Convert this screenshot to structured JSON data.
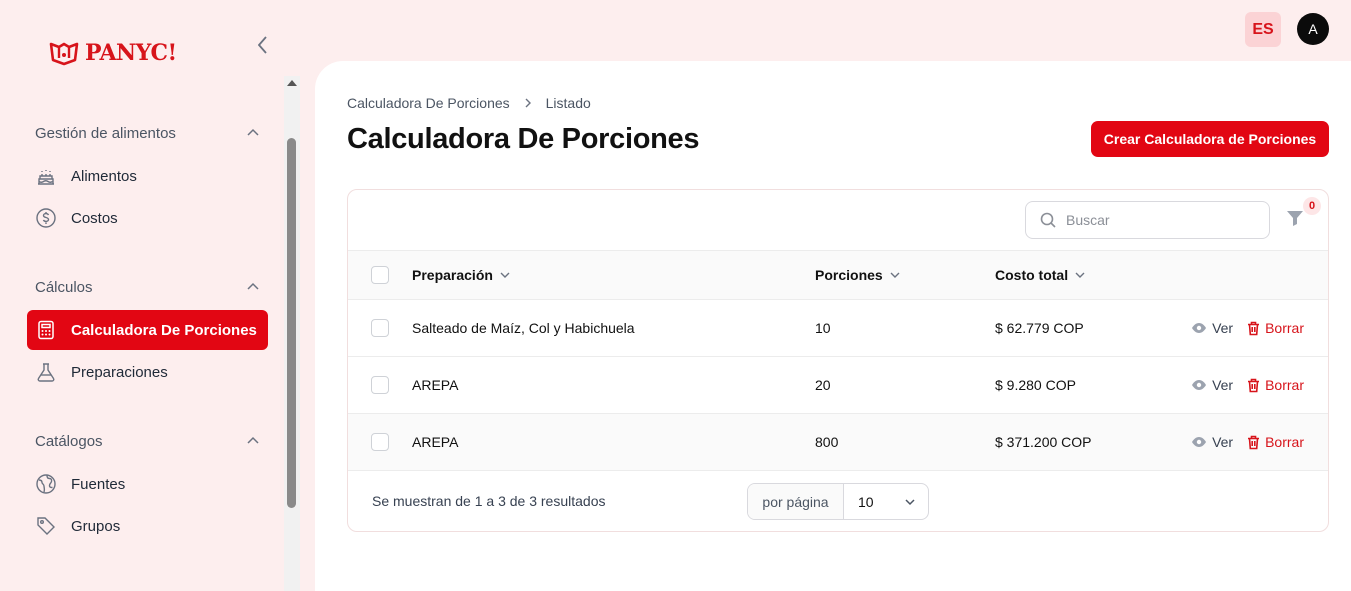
{
  "app": {
    "logo_text": "PANYC!"
  },
  "topbar": {
    "lang": "ES",
    "avatar_initial": "A"
  },
  "sidebar": {
    "groups": [
      {
        "label": "Gestión de alimentos",
        "items": [
          {
            "label": "Alimentos",
            "icon": "cake-icon"
          },
          {
            "label": "Costos",
            "icon": "dollar-circle-icon"
          }
        ]
      },
      {
        "label": "Cálculos",
        "items": [
          {
            "label": "Calculadora De Porciones",
            "icon": "calculator-icon",
            "active": true
          },
          {
            "label": "Preparaciones",
            "icon": "flask-icon"
          }
        ]
      },
      {
        "label": "Catálogos",
        "items": [
          {
            "label": "Fuentes",
            "icon": "globe-icon"
          },
          {
            "label": "Grupos",
            "icon": "tag-icon"
          }
        ]
      }
    ]
  },
  "main": {
    "breadcrumb": [
      "Calculadora De Porciones",
      "Listado"
    ],
    "title": "Calculadora De Porciones",
    "create_button": "Crear Calculadora de Porciones",
    "search_placeholder": "Buscar",
    "filter_count": "0",
    "columns": {
      "prep": "Preparación",
      "portions": "Porciones",
      "cost": "Costo total"
    },
    "rows": [
      {
        "prep": "Salteado de Maíz, Col y Habichuela",
        "portions": "10",
        "cost": "$ 62.779 COP"
      },
      {
        "prep": "AREPA",
        "portions": "20",
        "cost": "$ 9.280 COP"
      },
      {
        "prep": "AREPA",
        "portions": "800",
        "cost": "$ 371.200 COP"
      }
    ],
    "actions": {
      "view": "Ver",
      "delete": "Borrar"
    },
    "summary": "Se muestran de 1 a 3 de 3 resultados",
    "per_page_label": "por página",
    "per_page_value": "10"
  },
  "colors": {
    "accent": "#e20613",
    "background": "#fdeeee"
  }
}
